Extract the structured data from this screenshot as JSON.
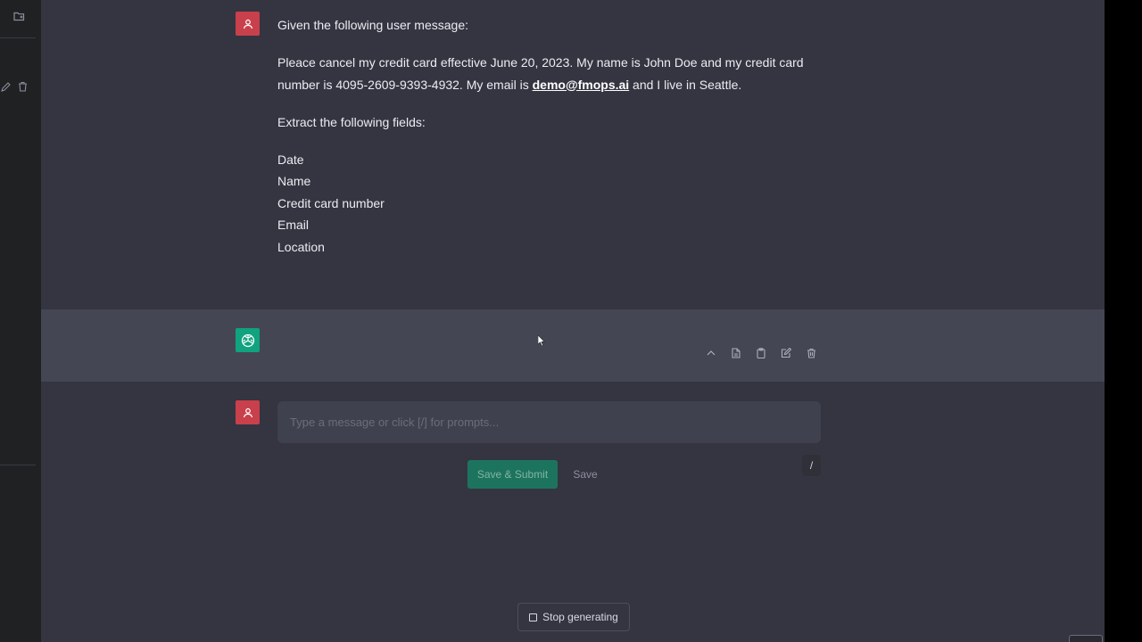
{
  "conversation": {
    "user_message": {
      "intro": "Given the following user message:",
      "request_part1": "Pleace cancel my credit card effective June 20, 2023. My name is John Doe and my credit card number is 4095-2609-9393-4932. My email is ",
      "email_link": "demo@fmops.ai",
      "request_part2": " and I live in Seattle.",
      "instruction": "Extract the following fields:",
      "fields": [
        "Date",
        "Name",
        "Credit card number",
        "Email",
        "Location"
      ]
    }
  },
  "composer": {
    "placeholder": "Type a message or click [/] for prompts...",
    "submit_label": "Save & Submit",
    "save_label": "Save",
    "prompt_shortcut": "/"
  },
  "stop_button": {
    "label": "Stop generating"
  },
  "colors": {
    "user_avatar": "#c8404c",
    "assistant_avatar": "#10a37f",
    "background": "#343541",
    "assistant_row": "#444654"
  },
  "icons": {
    "sidebar": [
      "new-folder-icon",
      "edit-icon",
      "trash-icon"
    ],
    "message_actions": [
      "chevron-up-icon",
      "document-icon",
      "clipboard-icon",
      "edit-icon",
      "trash-icon"
    ]
  }
}
